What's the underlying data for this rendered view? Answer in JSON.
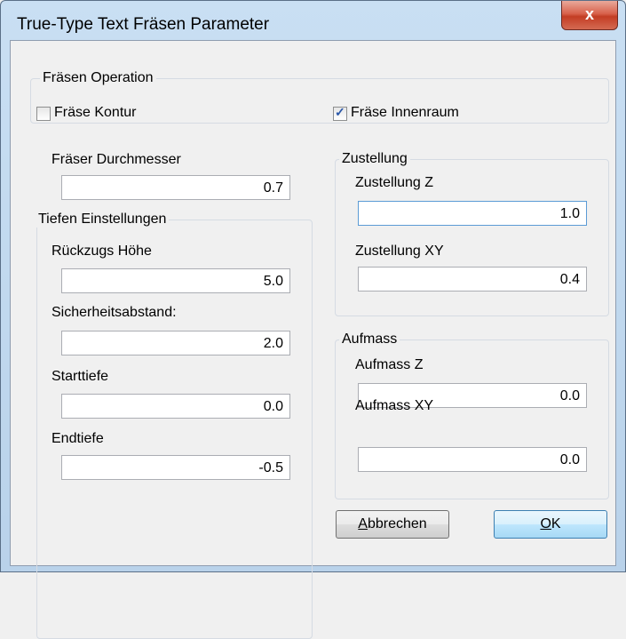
{
  "window": {
    "title": "True-Type Text Fräsen Parameter",
    "close_glyph": "x"
  },
  "fraesen_operation": {
    "legend": "Fräsen Operation",
    "kontur": {
      "label": "Fräse Kontur",
      "checked": false
    },
    "innenraum": {
      "label": "Fräse Innenraum",
      "checked": true
    }
  },
  "fraeser_durchmesser": {
    "label": "Fräser Durchmesser",
    "value": "0.7"
  },
  "tiefen": {
    "legend": "Tiefen Einstellungen",
    "rueckzugs_hoehe": {
      "label": "Rückzugs Höhe",
      "value": "5.0"
    },
    "sicherheitsabstand": {
      "label": "Sicherheitsabstand:",
      "value": "2.0"
    },
    "starttiefe": {
      "label": "Starttiefe",
      "value": "0.0"
    },
    "endtiefe": {
      "label": "Endtiefe",
      "value": "-0.5"
    }
  },
  "zustellung": {
    "legend": "Zustellung",
    "z": {
      "label": "Zustellung Z",
      "value": "1.0"
    },
    "xy": {
      "label": "Zustellung XY",
      "value": "0.4"
    }
  },
  "aufmass": {
    "legend": "Aufmass",
    "z": {
      "label": "Aufmass Z",
      "value": "0.0"
    },
    "xy": {
      "label": "Aufmass XY",
      "value": "0.0"
    }
  },
  "buttons": {
    "cancel": {
      "mnemonic": "A",
      "rest": "bbrechen"
    },
    "ok": {
      "mnemonic": "O",
      "rest": "K"
    }
  }
}
